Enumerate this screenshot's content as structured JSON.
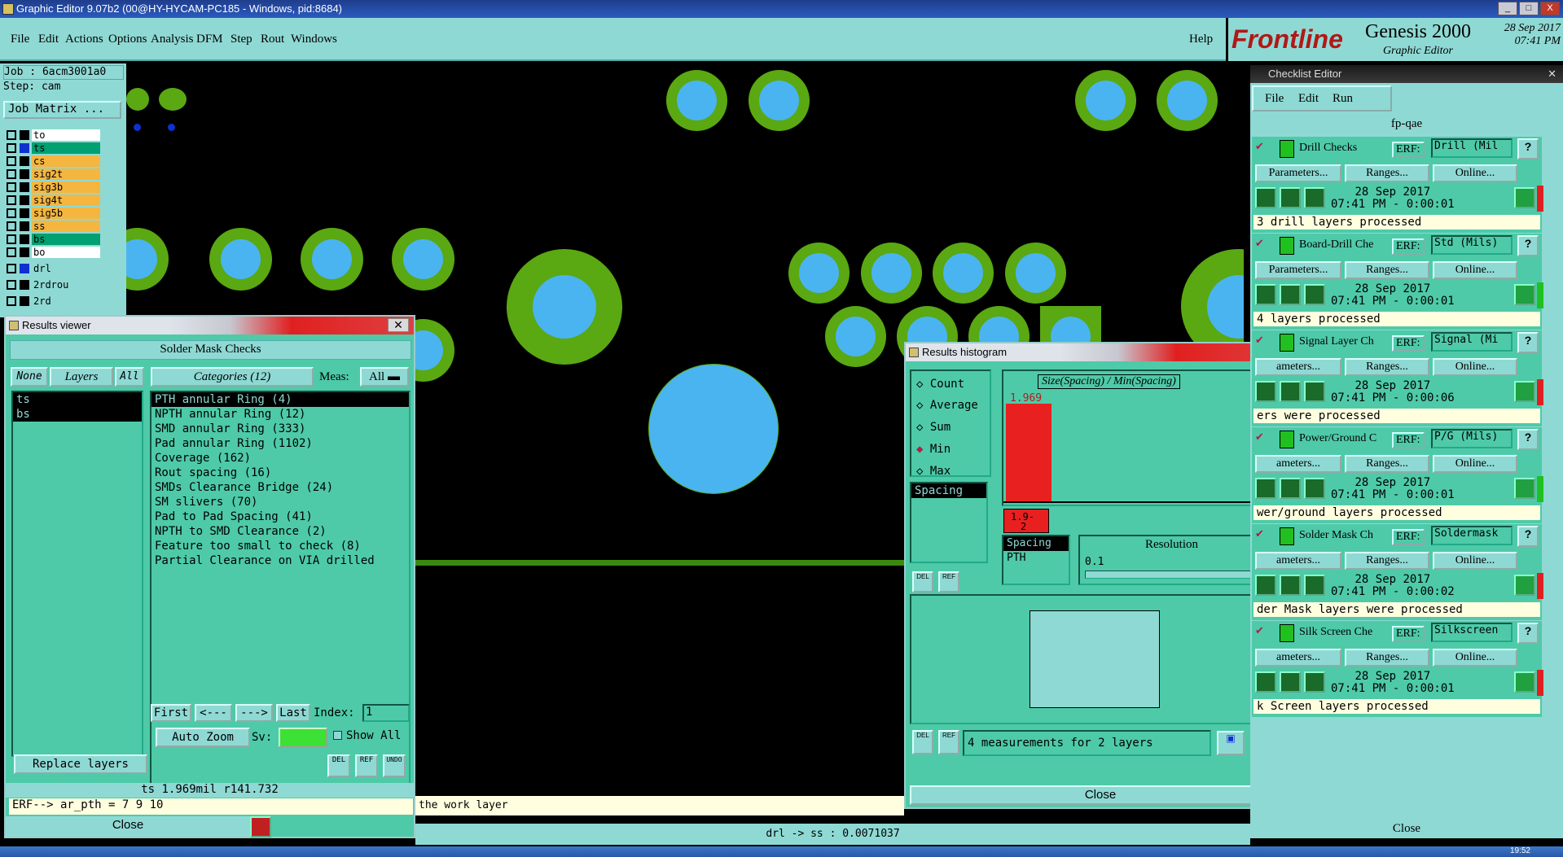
{
  "window": {
    "title": "Graphic Editor 9.07b2 (00@HY-HYCAM-PC185 - Windows, pid:8684)",
    "min": "_",
    "max": "□",
    "close": "X"
  },
  "menu": [
    "File",
    "Edit",
    "Actions",
    "Options",
    "Analysis",
    "DFM",
    "Step",
    "Rout",
    "Windows"
  ],
  "help": "Help",
  "logo": {
    "brand": "Frontline",
    "product": "Genesis 2000",
    "sub": "Graphic Editor",
    "date": "28 Sep 2017",
    "time": "07:41 PM"
  },
  "job": {
    "job": "Job : 6acm3001a0",
    "step": "Step: cam",
    "matrix": "Job Matrix ..."
  },
  "layers": [
    {
      "name": "to",
      "color": "#ffffff"
    },
    {
      "name": "ts",
      "color": "#00a070"
    },
    {
      "name": "cs",
      "color": "#f5b640"
    },
    {
      "name": "sig2t",
      "color": "#f5b640"
    },
    {
      "name": "sig3b",
      "color": "#f5b640"
    },
    {
      "name": "sig4t",
      "color": "#f5b640"
    },
    {
      "name": "sig5b",
      "color": "#f5b640"
    },
    {
      "name": "ss",
      "color": "#f5b640"
    },
    {
      "name": "bs",
      "color": "#00a070"
    },
    {
      "name": "bo",
      "color": "#ffffff"
    },
    {
      "name": "drl",
      "color": "#8fd9d4"
    },
    {
      "name": "2rdrou",
      "color": "#8fd9d4"
    },
    {
      "name": "2rd",
      "color": "#8fd9d4"
    }
  ],
  "results_viewer": {
    "title": "Results viewer",
    "heading": "Solder Mask Checks",
    "none": "None",
    "layers_btn": "Layers",
    "all": "All",
    "categories_btn": "Categories (12)",
    "meas_label": "Meas:",
    "meas_value": "All",
    "layer_list": [
      "ts",
      "bs"
    ],
    "categories": [
      "PTH annular Ring (4)",
      "NPTH annular Ring (12)",
      "SMD annular Ring (333)",
      "Pad annular Ring (1102)",
      "Coverage (162)",
      "Rout spacing (16)",
      "SMDs Clearance Bridge (24)",
      "SM slivers (70)",
      "Pad to Pad Spacing (41)",
      "NPTH to SMD Clearance (2)",
      "Feature too small to check (8)",
      "Partial Clearance on VIA drilled"
    ],
    "first": "First",
    "prev": "<---",
    "next": "--->",
    "last": "Last",
    "index_label": "Index:",
    "index_value": "1",
    "auto_zoom": "Auto Zoom",
    "sv": "Sv:",
    "show_all": "Show All",
    "replace_layers": "Replace layers",
    "del": "DEL",
    "ref": "REF",
    "undo": "UNDO",
    "measure": "ts 1.969mil  r141.732",
    "erf": "ERF--> ar_pth = 7 9 10",
    "close": "Close"
  },
  "histogram": {
    "title": "Results histogram",
    "options": [
      "Count",
      "Average",
      "Sum",
      "Min",
      "Max"
    ],
    "selected": "Min",
    "chart_title": "Size(Spacing) / Min(Spacing)",
    "bar_value": "1.969",
    "bar_label_a": "1.9-",
    "bar_label_b": "2",
    "list": [
      "Spacing"
    ],
    "list2": [
      "Spacing",
      "PTH"
    ],
    "resolution_label": "Resolution",
    "resolution_value": "0.1",
    "summary": "4 measurements for 2 layers",
    "close": "Close",
    "del": "DEL",
    "ref": "REF"
  },
  "checklist": {
    "title": "Checklist Editor",
    "menu": [
      "File",
      "Edit",
      "Run"
    ],
    "name": "fp-qae",
    "items": [
      {
        "name": "Drill Checks",
        "erf": "Drill (Mil",
        "date": "28 Sep 2017",
        "time": "07:41 PM - 0:00:01",
        "msg": "3 drill layers processed",
        "status": "#e02020"
      },
      {
        "name": "Board-Drill Che",
        "erf": "Std (Mils)",
        "date": "28 Sep 2017",
        "time": "07:41 PM - 0:00:01",
        "msg": "4 layers processed",
        "status": "#20c020"
      },
      {
        "name": "Signal Layer Ch",
        "erf": "Signal (Mi",
        "date": "28 Sep 2017",
        "time": "07:41 PM - 0:00:06",
        "msg": "ers were processed",
        "status": "#e02020"
      },
      {
        "name": "Power/Ground C",
        "erf": "P/G (Mils)",
        "date": "28 Sep 2017",
        "time": "07:41 PM - 0:00:01",
        "msg": "wer/ground layers processed",
        "status": "#20c020"
      },
      {
        "name": "Solder Mask Ch",
        "erf": "Soldermask",
        "date": "28 Sep 2017",
        "time": "07:41 PM - 0:00:02",
        "msg": "der Mask layers were processed",
        "status": "#e02020"
      },
      {
        "name": "Silk Screen Che",
        "erf": "Silkscreen",
        "date": "28 Sep 2017",
        "time": "07:41 PM - 0:00:01",
        "msg": "k Screen layers processed",
        "status": "#e02020"
      }
    ],
    "erf_label": "ERF:",
    "params": "Parameters...",
    "ranges": "Ranges...",
    "online": "Online...",
    "params_short": "ameters...",
    "close": "Close"
  },
  "status": {
    "work": "the work layer",
    "coord": "drl -> ss : 0.0071037"
  },
  "taskbar": {
    "clock": "19:52"
  }
}
